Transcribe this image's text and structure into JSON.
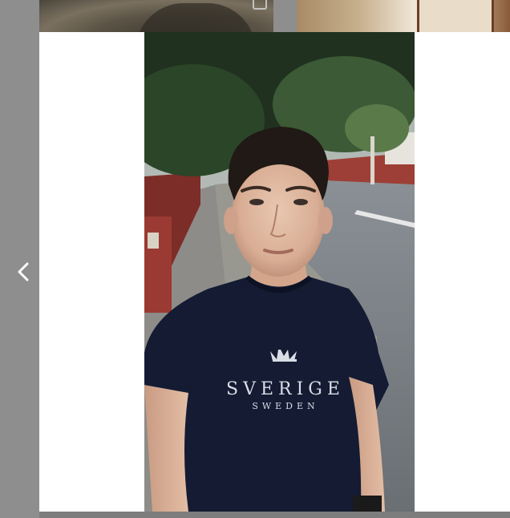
{
  "viewer": {
    "nav_prev_icon": "chevron-left-icon",
    "thumb_left_icon": "corner-frame-icon"
  },
  "photo": {
    "subject": "selfie",
    "shirt_text_main": "SVERIGE",
    "shirt_text_sub": "SWEDEN",
    "shirt_icon": "crown-icon"
  },
  "colors": {
    "page_bg": "#8e8e8e",
    "lightbox_bg": "#ffffff",
    "shirt": "#141b33",
    "shirt_print": "#d9dde6"
  }
}
